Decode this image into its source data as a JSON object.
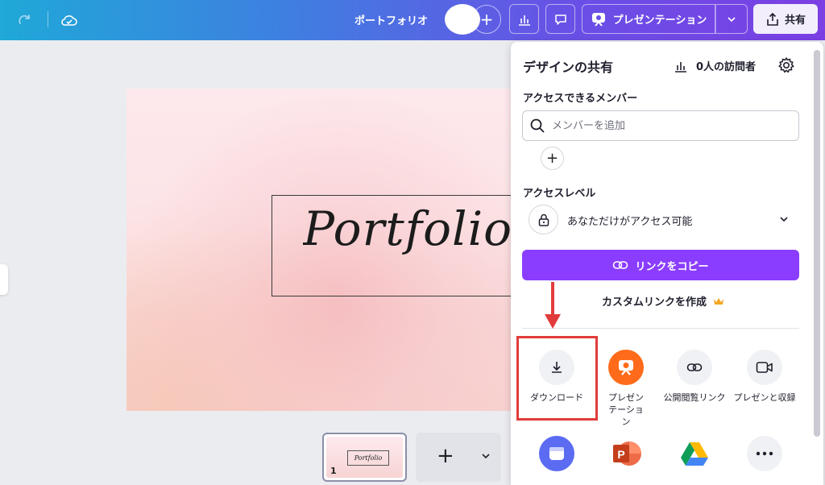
{
  "topbar": {
    "design_title": "ポートフォリオ",
    "present_label": "プレゼンテーション",
    "share_label": "共有"
  },
  "canvas": {
    "slide_title": "Portfolio",
    "thumbnail_title": "Portfolio",
    "page_number": "1"
  },
  "share_panel": {
    "title": "デザインの共有",
    "visitors": "0人の訪問者",
    "members_label": "アクセスできるメンバー",
    "member_placeholder": "メンバーを追加",
    "access_level_label": "アクセスレベル",
    "access_level_value": "あなただけがアクセス可能",
    "copy_link_label": "リンクをコピー",
    "custom_link_label": "カスタムリンクを作成",
    "options": [
      {
        "label": "ダウンロード",
        "icon": "download-icon"
      },
      {
        "label": "プレゼンテーション",
        "icon": "present-icon"
      },
      {
        "label": "公開閲覧リンク",
        "icon": "link-icon"
      },
      {
        "label": "プレゼンと収録",
        "icon": "video-camera-icon"
      }
    ],
    "apps": [
      {
        "icon": "calendar-app-icon"
      },
      {
        "icon": "powerpoint-icon"
      },
      {
        "icon": "google-drive-icon"
      },
      {
        "icon": "more-icon"
      }
    ]
  },
  "colors": {
    "accent": "#8b3dff",
    "highlight": "#e23b3b",
    "present_orange": "#ff6b1a"
  }
}
